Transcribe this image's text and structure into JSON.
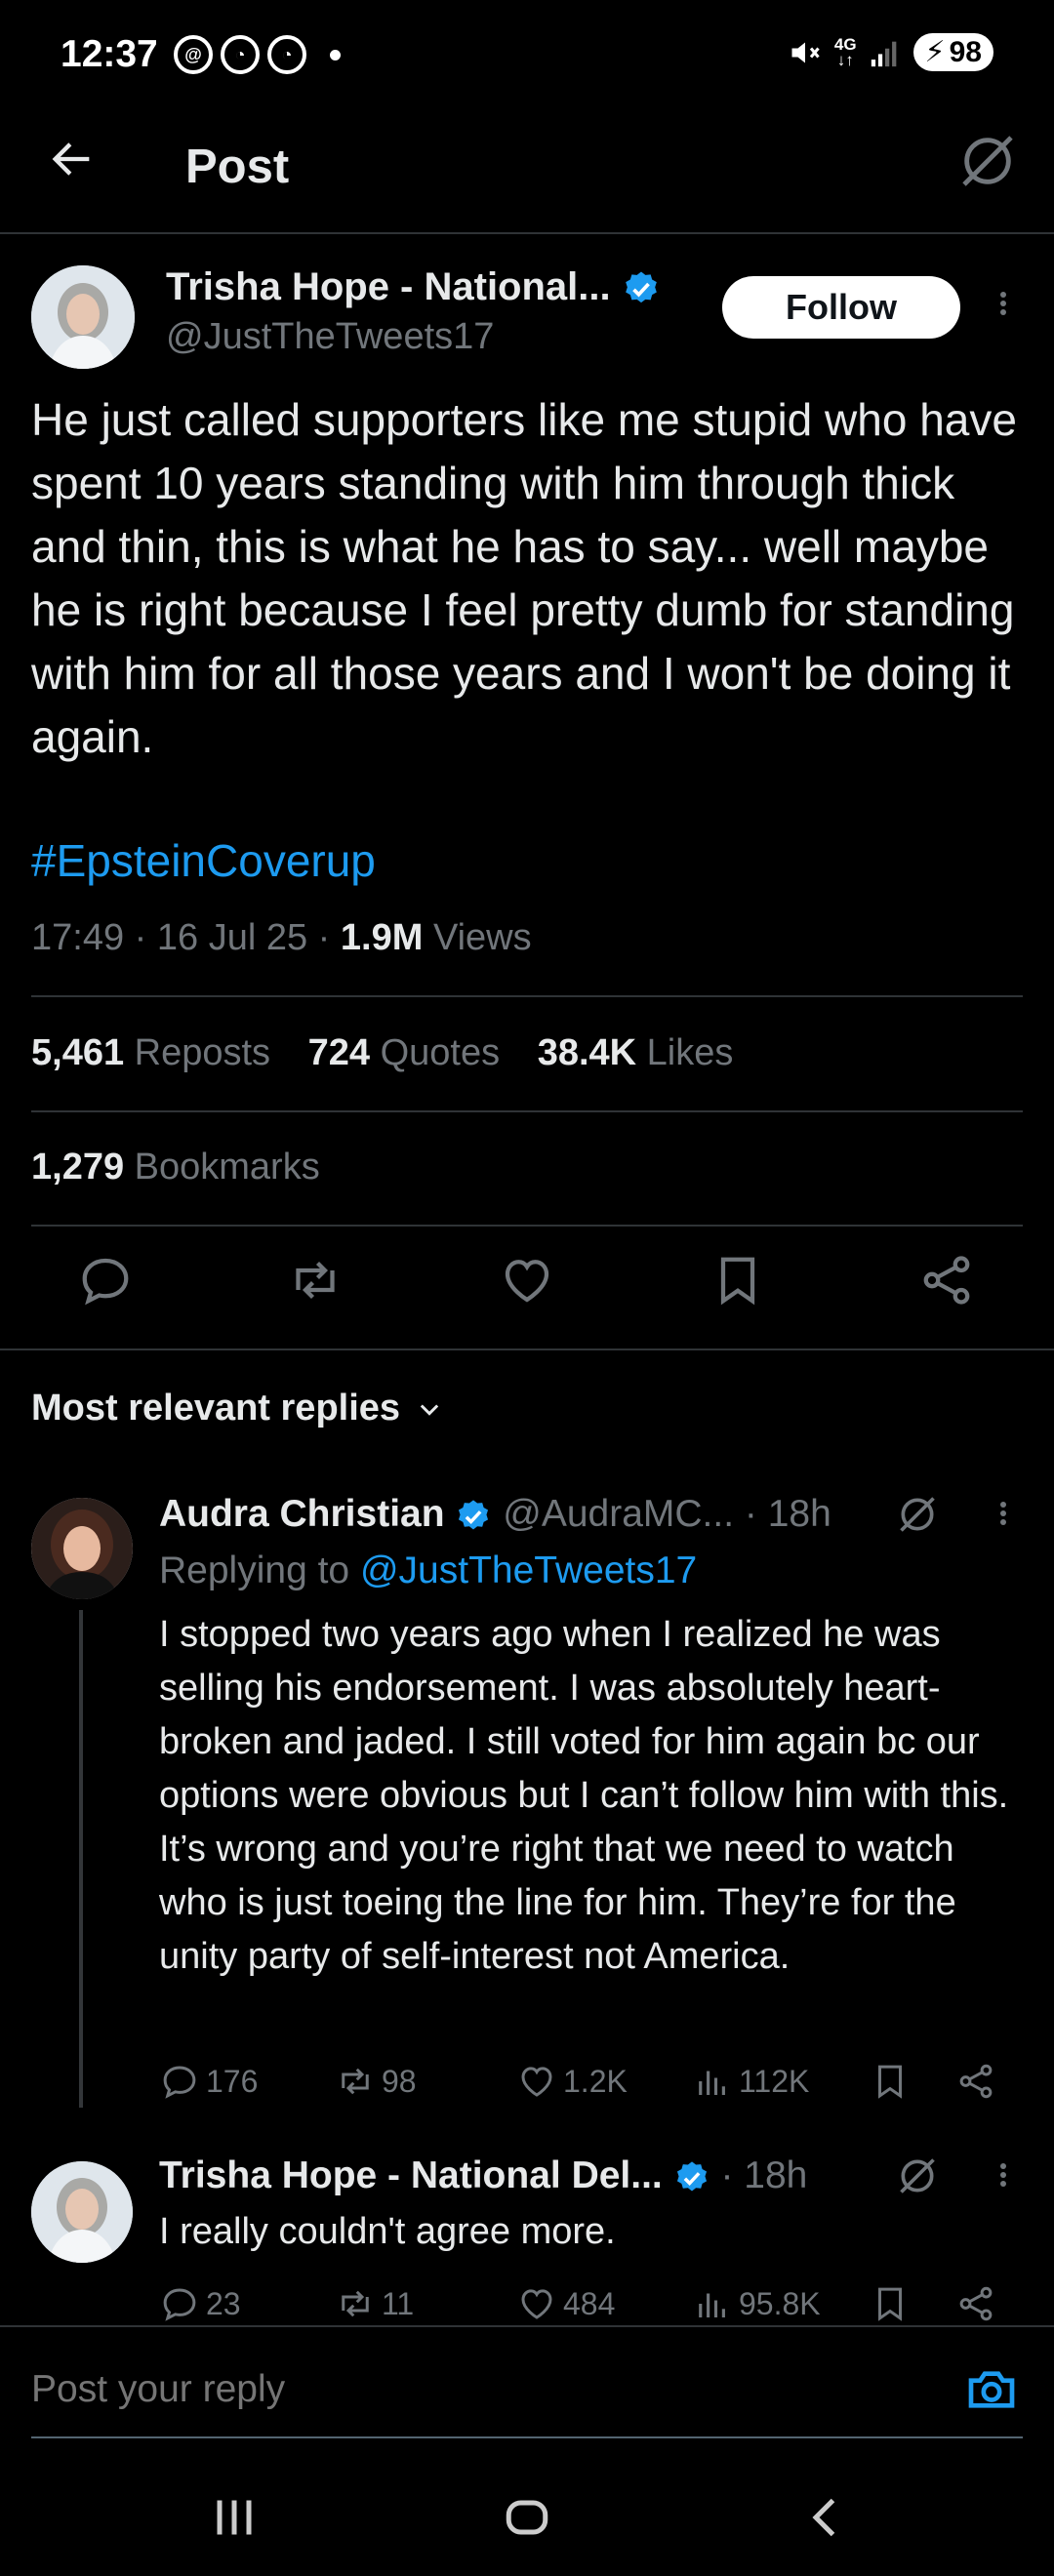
{
  "status_bar": {
    "time": "12:37",
    "network": "4G",
    "battery": "98"
  },
  "header": {
    "title": "Post"
  },
  "post": {
    "author_name": "Trisha Hope - National...",
    "handle": "@JustTheTweets17",
    "follow_label": "Follow",
    "text": "He just called supporters like me stupid who have spent 10 years standing with him through thick and thin, this is what he has to say... well maybe he is right because I feel pretty dumb for standing with him for all those years and I won't be doing it again.",
    "hashtag": "#EpsteinCoverup",
    "time": "17:49",
    "date": "16 Jul 25",
    "views_count": "1.9M",
    "views_label": "Views",
    "reposts_count": "5,461",
    "reposts_label": "Reposts",
    "quotes_count": "724",
    "quotes_label": "Quotes",
    "likes_count": "38.4K",
    "likes_label": "Likes",
    "bookmarks_count": "1,279",
    "bookmarks_label": "Bookmarks"
  },
  "replies_section": {
    "filter_label": "Most relevant replies"
  },
  "replies": [
    {
      "name": "Audra Christian",
      "handle": "@AudraMC...",
      "age": "18h",
      "replying_prefix": "Replying to",
      "replying_to": "@JustTheTweets17",
      "text": "I stopped two years ago when I realized he was selling his endorsement. I was absolutely heart-broken and jaded. I still voted for him again bc our options were obvious but I can’t follow him with this. It’s wrong and you’re right that we need to watch who is just toeing the line for him. They’re for the unity party of self-interest not America.",
      "replies": "176",
      "reposts": "98",
      "likes": "1.2K",
      "views": "112K"
    },
    {
      "name": "Trisha Hope - National Del...",
      "age": "18h",
      "text": "I really couldn't agree more.",
      "replies": "23",
      "reposts": "11",
      "likes": "484",
      "views": "95.8K"
    }
  ],
  "compose": {
    "placeholder": "Post your reply"
  },
  "colors": {
    "background": "#000000",
    "text": "#e7e9ea",
    "secondary": "#71767b",
    "accent": "#1d9bf0",
    "divider": "#2f3336"
  }
}
